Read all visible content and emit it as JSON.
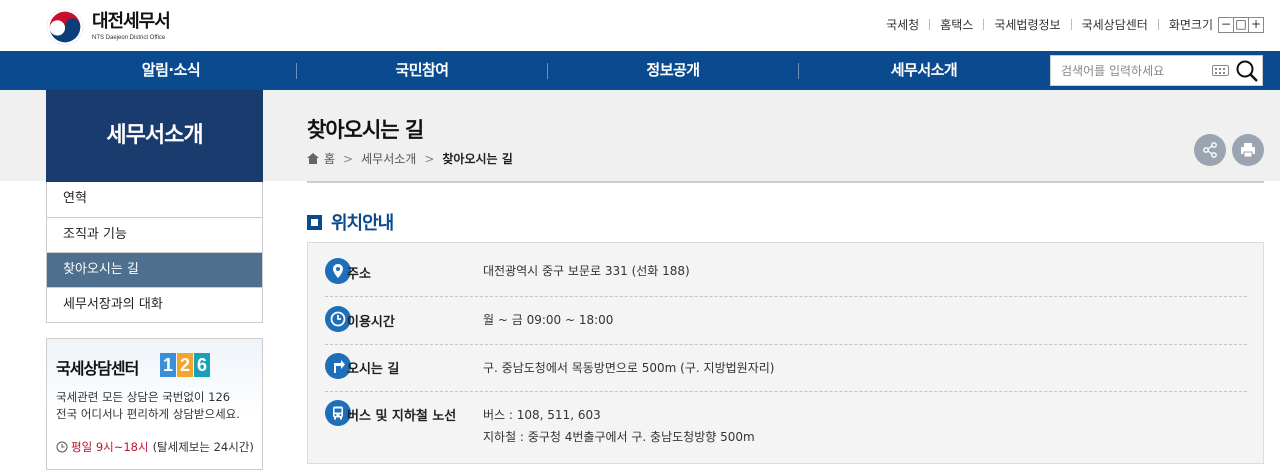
{
  "header": {
    "logo_title": "대전세무서",
    "logo_sub": "NTS Daejeon District Office",
    "util_links": [
      "국세청",
      "홈택스",
      "국세법령정보",
      "국세상담센터",
      "화면크기"
    ],
    "zoom": [
      "−",
      "□",
      "+"
    ]
  },
  "gnb": {
    "items": [
      "알림·소식",
      "국민참여",
      "정보공개",
      "세무서소개"
    ],
    "search_placeholder": "검색어를 입력하세요"
  },
  "sidebar": {
    "title": "세무서소개",
    "items": [
      {
        "label": "연혁",
        "active": false
      },
      {
        "label": "조직과 기능",
        "active": false
      },
      {
        "label": "찾아오시는 길",
        "active": true
      },
      {
        "label": "세무서장과의 대화",
        "active": false
      }
    ],
    "call_center": {
      "title": "국세상담센터",
      "digits": [
        "1",
        "2",
        "6"
      ],
      "digit_colors": [
        "#3b8fd8",
        "#f2a52a",
        "#1aa1b8"
      ],
      "desc_line1": "국세관련 모든 상담은 국번없이 126",
      "desc_line2": "전국 어디서나 편리하게 상담받으세요.",
      "hours_red": "평일 9시~18시",
      "hours_note": "(탈세제보는 24시간)"
    }
  },
  "content": {
    "page_title": "찾아오시는 길",
    "breadcrumb": [
      "홈",
      "세무서소개",
      "찾아오시는 길"
    ],
    "section_title": "위치안내",
    "rows": [
      {
        "icon": "location-pin-icon",
        "label": "주소",
        "values": [
          "대전광역시 중구 보문로 331 (선화 188)"
        ]
      },
      {
        "icon": "clock-icon",
        "label": "이용시간",
        "values": [
          "월 ~ 금 09:00 ~ 18:00"
        ]
      },
      {
        "icon": "directions-icon",
        "label": "오시는 길",
        "values": [
          "구. 중남도청에서 목동방면으로 500m (구. 지방법원자리)"
        ]
      },
      {
        "icon": "bus-icon",
        "label": "버스 및 지하철 노선",
        "values": [
          "버스 : 108, 511, 603",
          "지하철 : 중구청 4번출구에서 구. 충남도청방향 500m"
        ]
      }
    ]
  },
  "colors": {
    "gnb": "#0a4b8f",
    "sidebar_title": "#1a3b6e",
    "active_item": "#4e6f8e",
    "icon_blue": "#1e6fb8",
    "accent_red": "#c8102e"
  }
}
